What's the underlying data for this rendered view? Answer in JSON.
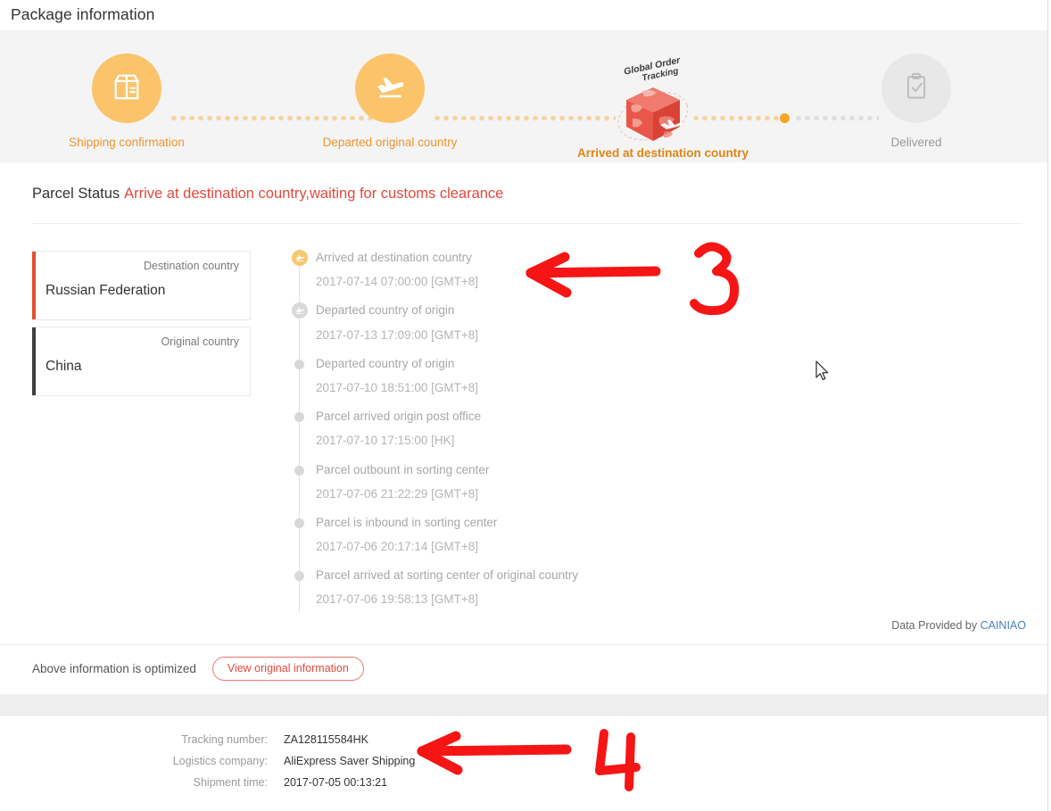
{
  "page": {
    "title": "Package information"
  },
  "tracker": {
    "steps": [
      {
        "label": "Shipping confirmation",
        "icon": "package-box-icon",
        "state": "active"
      },
      {
        "label": "Departed original country",
        "icon": "airplane-takeoff-icon",
        "state": "active"
      },
      {
        "label": "Arrived at destination country",
        "icon": "global-order-tracking-cube-icon",
        "state": "current"
      },
      {
        "label": "Delivered",
        "icon": "clipboard-check-icon",
        "state": "inactive"
      }
    ],
    "cube_caption_line1": "Global Order",
    "cube_caption_line2": "Tracking",
    "colors": {
      "active": "#fbc46a",
      "inactive": "#e8e8e8",
      "active_label": "#f0962e",
      "current_label": "#e08515",
      "inactive_label": "#9a9a9a",
      "dot_orange": "#f5a623",
      "dot_track": "#f7d2a0",
      "band_bg": "#f4f4f4"
    }
  },
  "status": {
    "label": "Parcel Status",
    "value": "Arrive at destination country,waiting for customs clearance",
    "value_color": "#e4483c"
  },
  "countries": [
    {
      "label": "Destination country",
      "value": "Russian Federation",
      "accent": "#e2502e"
    },
    {
      "label": "Original country",
      "value": "China",
      "accent": "#3f3f3f"
    }
  ],
  "timeline": [
    {
      "title": "Arrived at destination country",
      "time": "2017-07-14 07:00:00 [GMT+8]",
      "node": "airplane-landing-icon",
      "node_state": "amber"
    },
    {
      "title": "Departed country of origin",
      "time": "2017-07-13 17:09:00 [GMT+8]",
      "node": "airplane-takeoff-icon",
      "node_state": "gray"
    },
    {
      "title": "Departed country of origin",
      "time": "2017-07-10 18:51:00 [GMT+8]",
      "node": "dot",
      "node_state": "plain"
    },
    {
      "title": "Parcel arrived origin post office",
      "time": "2017-07-10 17:15:00 [HK]",
      "node": "dot",
      "node_state": "plain"
    },
    {
      "title": "Parcel outbount in sorting center",
      "time": "2017-07-06 21:22:29 [GMT+8]",
      "node": "dot",
      "node_state": "plain"
    },
    {
      "title": "Parcel is inbound in sorting center",
      "time": "2017-07-06 20:17:14 [GMT+8]",
      "node": "dot",
      "node_state": "plain"
    },
    {
      "title": "Parcel arrived at sorting center of original country",
      "time": "2017-07-06 19:58:13 [GMT+8]",
      "node": "dot",
      "node_state": "plain"
    }
  ],
  "provider": {
    "prefix": "Data Provided by ",
    "brand": "CAINIAO",
    "brand_color": "#4a7ebb"
  },
  "optimized": {
    "note": "Above information is optimized",
    "button_label": "View original information",
    "button_color": "#e4483c"
  },
  "shipment": {
    "rows": [
      {
        "key": "Tracking number:",
        "value": "ZA128115584HK"
      },
      {
        "key": "Logistics company:",
        "value": "AliExpress Saver Shipping"
      },
      {
        "key": "Shipment time:",
        "value": "2017-07-05 00:13:21"
      }
    ]
  },
  "annotations": [
    {
      "name": "red-arrow-left-upper",
      "number": "3",
      "color": "#f61515"
    },
    {
      "name": "red-arrow-left-lower",
      "number": "4",
      "color": "#f61515"
    }
  ]
}
